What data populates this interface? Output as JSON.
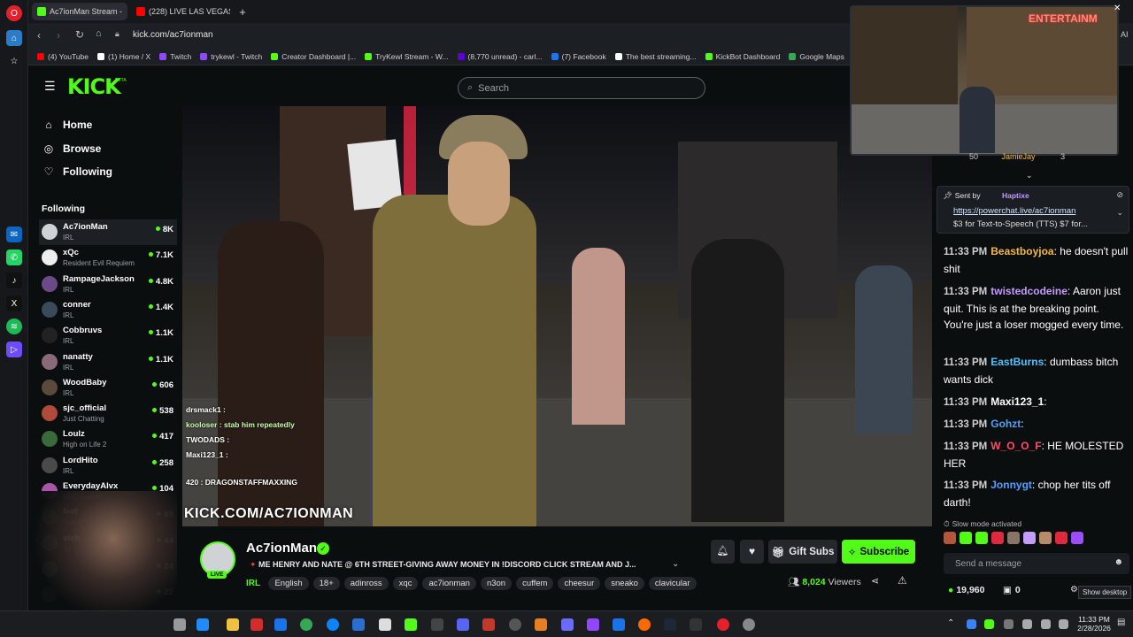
{
  "browser": {
    "tabs": [
      {
        "label": "Ac7ionMan Stream - "
      },
      {
        "label": "(228) LIVE LAS VEGAS"
      }
    ],
    "new_tab": "+",
    "url": "kick.com/ac7ionman",
    "bookmarks": [
      {
        "label": "(4) YouTube",
        "color": "#ff0000"
      },
      {
        "label": "(1) Home / X",
        "color": "#ffffff"
      },
      {
        "label": "Twitch",
        "color": "#9146ff"
      },
      {
        "label": "trykewl - Twitch",
        "color": "#9146ff"
      },
      {
        "label": "Creator Dashboard |...",
        "color": "#53fc18"
      },
      {
        "label": "TryKewl Stream - W...",
        "color": "#53fc18"
      },
      {
        "label": "(8,770 unread) - carl...",
        "color": "#6001d2"
      },
      {
        "label": "(7) Facebook",
        "color": "#1877f2"
      },
      {
        "label": "The best streaming...",
        "color": "#ffffff"
      },
      {
        "label": "KickBot Dashboard",
        "color": "#53fc18"
      },
      {
        "label": "Google Maps",
        "color": "#34a853"
      },
      {
        "label": "Hom",
        "color": "#4a90e2"
      }
    ],
    "top_right": "AI"
  },
  "header": {
    "logo": "KICK",
    "logo_badge": "BETA",
    "search_placeholder": "Search"
  },
  "sidebar": {
    "nav": [
      {
        "label": "Home",
        "icon": "home-icon"
      },
      {
        "label": "Browse",
        "icon": "compass-icon"
      },
      {
        "label": "Following",
        "icon": "heart-icon"
      }
    ],
    "following_title": "Following",
    "following": [
      {
        "name": "Ac7ionMan",
        "game": "IRL",
        "viewers": "8K"
      },
      {
        "name": "xQc",
        "game": "Resident Evil Requiem",
        "viewers": "7.1K"
      },
      {
        "name": "RampageJackson",
        "game": "IRL",
        "viewers": "4.8K"
      },
      {
        "name": "conner",
        "game": "IRL",
        "viewers": "1.4K"
      },
      {
        "name": "Cobbruvs",
        "game": "IRL",
        "viewers": "1.1K"
      },
      {
        "name": "nanatty",
        "game": "IRL",
        "viewers": "1.1K"
      },
      {
        "name": "WoodBaby",
        "game": "IRL",
        "viewers": "606"
      },
      {
        "name": "sjc_official",
        "game": "Just Chatting",
        "viewers": "538"
      },
      {
        "name": "Loulz",
        "game": "High on Life 2",
        "viewers": "417"
      },
      {
        "name": "LordHito",
        "game": "IRL",
        "viewers": "258"
      },
      {
        "name": "EverydayAlvx",
        "game": "ARC Raiders",
        "viewers": "104"
      },
      {
        "name": "feef",
        "game": "Just C",
        "viewers": "69"
      },
      {
        "name": "atch",
        "game": "Ju",
        "viewers": "44"
      },
      {
        "name": "",
        "game": "",
        "viewers": "24"
      },
      {
        "name": "",
        "game": "",
        "viewers": "22"
      }
    ]
  },
  "video": {
    "watermark": "KICK.COM/AC7IONMAN",
    "overlay_chat": [
      "drsmack1 :",
      "kooloser : stab him repeatedly",
      "TWODADS :",
      "Maxi123_1 :",
      "420 : DRAGONSTAFFMAXXING"
    ]
  },
  "pip": {
    "sign_text": "ENTERTAINM"
  },
  "stream_info": {
    "channel": "Ac7ionMan",
    "live_badge": "LIVE",
    "title": "ME HENRY AND NATE @ 6TH STREET-GIVING AWAY MONEY IN !DISCORD CLICK STREAM AND J...",
    "category": "IRL",
    "tags": [
      "English",
      "18+",
      "adinross",
      "xqc",
      "ac7ionman",
      "n3on",
      "cuffem",
      "cheesur",
      "sneako",
      "clavicular"
    ],
    "gift_subs": "Gift Subs",
    "subscribe": "Subscribe",
    "viewers": "8,024",
    "viewers_label": "Viewers"
  },
  "chat": {
    "leaderboard": {
      "count": "50",
      "user": "JamieJay",
      "value": "3"
    },
    "pinned": {
      "sent_by": "Sent by",
      "sender": "Haptixe",
      "link": "https://powerchat.live/ac7ionman",
      "text": "$3 for Text-to-Speech (TTS) $7 for..."
    },
    "messages": [
      {
        "time": "11:33 PM",
        "user": "Beastboyjoa",
        "color": "#f5b942",
        "text": "he doesn't pull shit"
      },
      {
        "time": "11:33 PM",
        "user": "twistedcodeine",
        "color": "#c49bff",
        "text": "Aaron just quit. This is at the breaking point. You're just a loser mogged every time."
      },
      {
        "time": "11:33 PM",
        "user": "EastBurns",
        "color": "#53c1fc",
        "text": "dumbass bitch wants dick"
      },
      {
        "time": "11:33 PM",
        "user": "Maxi123_1",
        "color": "#ffffff",
        "text": ""
      },
      {
        "time": "11:33 PM",
        "user": "Gohzt",
        "color": "#53a0fc",
        "text": ""
      },
      {
        "time": "11:33 PM",
        "user": "W_O_O_F",
        "color": "#ff4d6a",
        "text": "HE MOLESTED HER"
      },
      {
        "time": "11:33 PM",
        "user": "Jonnygt",
        "color": "#53a0fc",
        "text": "chop her tits off darth!"
      }
    ],
    "slow_mode": "Slow mode activated",
    "input_placeholder": "Send a message",
    "points": "19,960",
    "gifts": "0",
    "show_desktop": "Show desktop"
  },
  "taskbar": {
    "time": "11:33 PM",
    "date": "2/28/2026"
  },
  "colors": {
    "kick_green": "#53fc18",
    "bg": "#0b0e0f"
  }
}
